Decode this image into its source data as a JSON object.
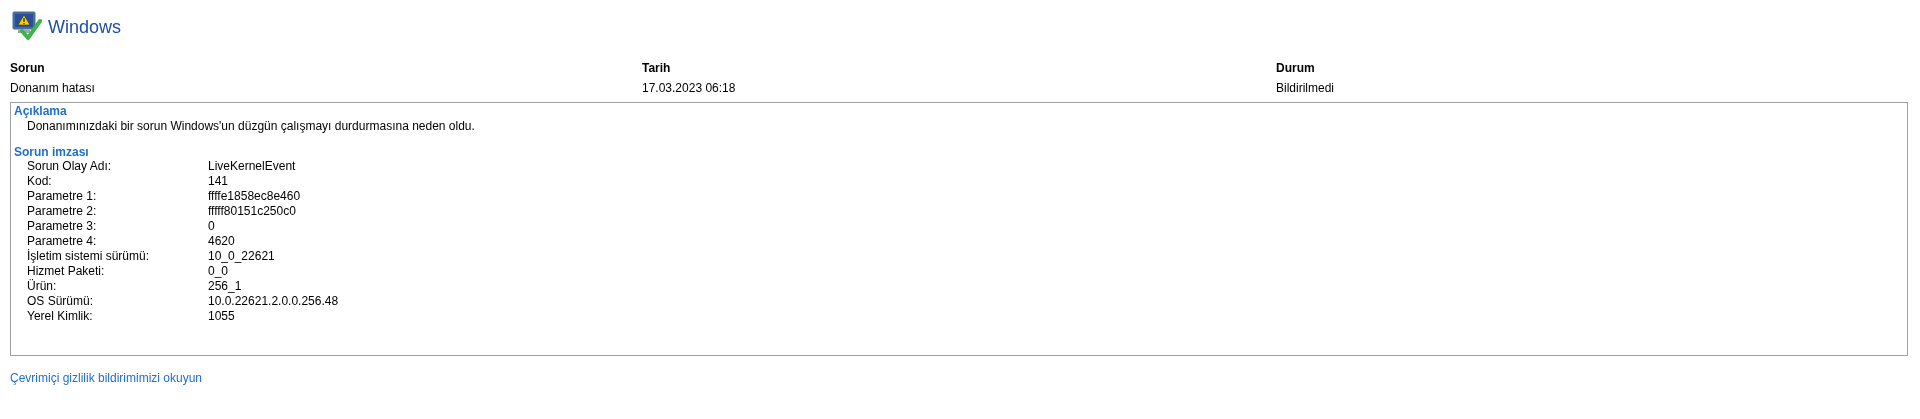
{
  "header": {
    "title": "Windows"
  },
  "summary": {
    "columns": [
      "Sorun",
      "Tarih",
      "Durum"
    ],
    "values": [
      "Donanım hatası",
      "17.03.2023 06:18",
      "Bildirilmedi"
    ]
  },
  "details": {
    "description_heading": "Açıklama",
    "description": "Donanımınızdaki bir sorun Windows'un düzgün çalışmayı durdurmasına neden oldu.",
    "signature_heading": "Sorun imzası",
    "signature": [
      {
        "label": "Sorun Olay Adı:",
        "value": "LiveKernelEvent"
      },
      {
        "label": "Kod:",
        "value": "141"
      },
      {
        "label": "Parametre 1:",
        "value": "ffffe1858ec8e460"
      },
      {
        "label": "Parametre 2:",
        "value": "fffff80151c250c0"
      },
      {
        "label": "Parametre 3:",
        "value": "0"
      },
      {
        "label": "Parametre 4:",
        "value": "4620"
      },
      {
        "label": "İşletim sistemi sürümü:",
        "value": "10_0_22621"
      },
      {
        "label": "Hizmet Paketi:",
        "value": "0_0"
      },
      {
        "label": "Ürün:",
        "value": "256_1"
      },
      {
        "label": "OS Sürümü:",
        "value": "10.0.22621.2.0.0.256.48"
      },
      {
        "label": "Yerel Kimlik:",
        "value": "1055"
      }
    ]
  },
  "privacy_link": "Çevrimiçi gizlilik bildirimimizi okuyun"
}
